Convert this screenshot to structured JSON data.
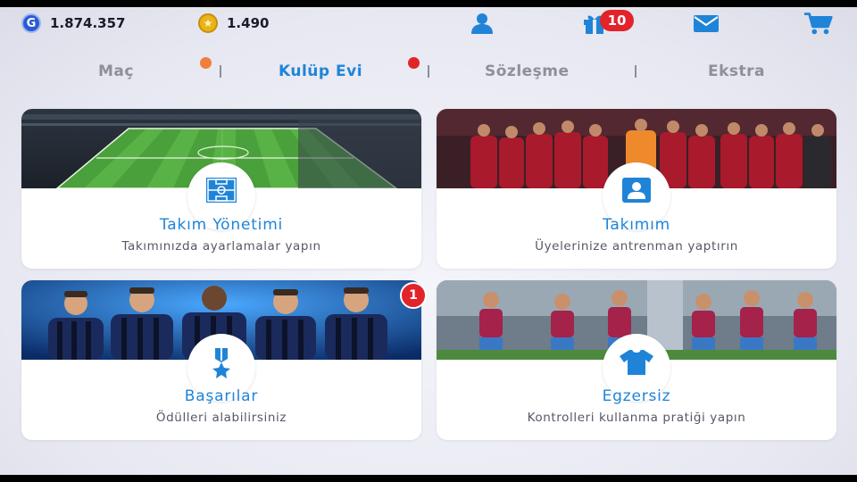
{
  "currencies": {
    "gp": {
      "icon": "gp-coin-icon",
      "symbol": "G",
      "value": "1.874.357"
    },
    "coins": {
      "icon": "star-coin-icon",
      "symbol": "★",
      "value": "1.490"
    }
  },
  "header_icons": {
    "gift_badge": "10"
  },
  "tabs": [
    {
      "label": "Maç"
    },
    {
      "label": "Kulüp Evi",
      "active": true
    },
    {
      "label": "Sözleşme"
    },
    {
      "label": "Ekstra"
    }
  ],
  "cards": [
    {
      "title": "Takım Yönetimi",
      "subtitle": "Takımınızda ayarlamalar yapın",
      "icon": "pitch-icon"
    },
    {
      "title": "Takımım",
      "subtitle": "Üyelerinize antrenman yaptırın",
      "icon": "player-card-icon"
    },
    {
      "title": "Başarılar",
      "subtitle": "Ödülleri alabilirsiniz",
      "icon": "medal-icon",
      "badge": "1"
    },
    {
      "title": "Egzersiz",
      "subtitle": "Kontrolleri kullanma pratiği yapın",
      "icon": "jersey-icon"
    }
  ],
  "colors": {
    "accent": "#1f84d8",
    "inactive_tab": "#8e8f99",
    "badge_red": "#e3232a",
    "dot_orange": "#f07f3c"
  }
}
